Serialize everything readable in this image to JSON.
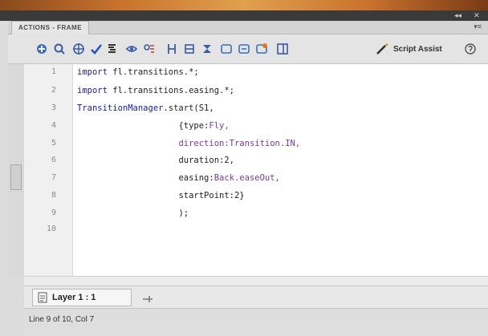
{
  "panel": {
    "tab_label": "ACTIONS - FRAME",
    "menu_icon": "panel-menu-icon"
  },
  "toolbar": {
    "script_assist_label": "Script Assist",
    "icons": [
      "add-script-icon",
      "find-icon",
      "insert-target-path-icon",
      "check-syntax-icon",
      "auto-format-icon",
      "show-code-hint-icon",
      "debug-options-icon",
      "collapse-between-braces-icon",
      "collapse-selection-icon",
      "expand-all-icon",
      "apply-block-comment-icon",
      "apply-line-comment-icon",
      "remove-comment-icon",
      "show-hide-toolbox-icon",
      "script-assist-icon",
      "help-icon"
    ]
  },
  "editor": {
    "line_numbers": [
      "1",
      "2",
      "3",
      "4",
      "5",
      "6",
      "7",
      "8",
      "9",
      "10"
    ],
    "code_lines": [
      {
        "kw": "import",
        "text": " fl.transitions.*;"
      },
      {
        "kw": "import",
        "text": " fl.transitions.easing.*;"
      },
      {
        "cls": "TransitionManager",
        "text": ".start(S1,"
      },
      {
        "pad": "                    ",
        "prop": "{type:",
        "val": "Fly,"
      },
      {
        "pad": "                    ",
        "prop": "direction:",
        "val": "Transition.IN,"
      },
      {
        "pad": "                    ",
        "prop": "duration:",
        "val": "2,"
      },
      {
        "pad": "                    ",
        "prop": "easing:",
        "val": "Back.easeOut,"
      },
      {
        "pad": "                    ",
        "prop": "startPoint:",
        "val": "2}"
      },
      {
        "pad": "                    ",
        "text": ");"
      },
      {
        "text": ""
      }
    ]
  },
  "layer": {
    "label": "Layer 1 : 1"
  },
  "status": {
    "text": "Line 9 of 10, Col 7"
  },
  "colors": {
    "keyword": "#1a1aa6",
    "property": "#7a3a9a",
    "text": "#222222"
  }
}
